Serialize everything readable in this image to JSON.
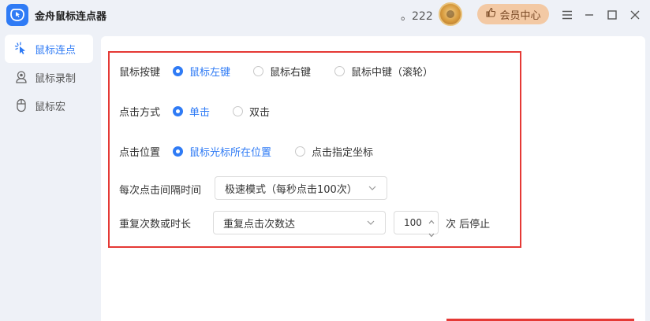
{
  "app": {
    "title": "金舟鼠标连点器"
  },
  "header": {
    "points": "。222",
    "vip_label": "会员中心"
  },
  "sidebar": {
    "items": [
      {
        "label": "鼠标连点",
        "icon": "click-sparkle-icon",
        "active": true
      },
      {
        "label": "鼠标录制",
        "icon": "record-person-icon",
        "active": false
      },
      {
        "label": "鼠标宏",
        "icon": "mouse-icon",
        "active": false
      }
    ]
  },
  "settings": {
    "mouse_button": {
      "label": "鼠标按键",
      "options": [
        "鼠标左键",
        "鼠标右键",
        "鼠标中键（滚轮）"
      ],
      "selected": "鼠标左键"
    },
    "click_mode": {
      "label": "点击方式",
      "options": [
        "单击",
        "双击"
      ],
      "selected": "单击"
    },
    "click_position": {
      "label": "点击位置",
      "options": [
        "鼠标光标所在位置",
        "点击指定坐标"
      ],
      "selected": "鼠标光标所在位置"
    },
    "interval": {
      "label": "每次点击间隔时间",
      "value": "极速模式（每秒点击100次）"
    },
    "repeat": {
      "label": "重复次数或时长",
      "mode": "重复点击次数达",
      "count": "100",
      "suffix": "次 后停止"
    }
  },
  "colors": {
    "accent": "#2f7bf5",
    "highlight_frame": "#e53935",
    "vip_bg": "#f3c9a4"
  }
}
